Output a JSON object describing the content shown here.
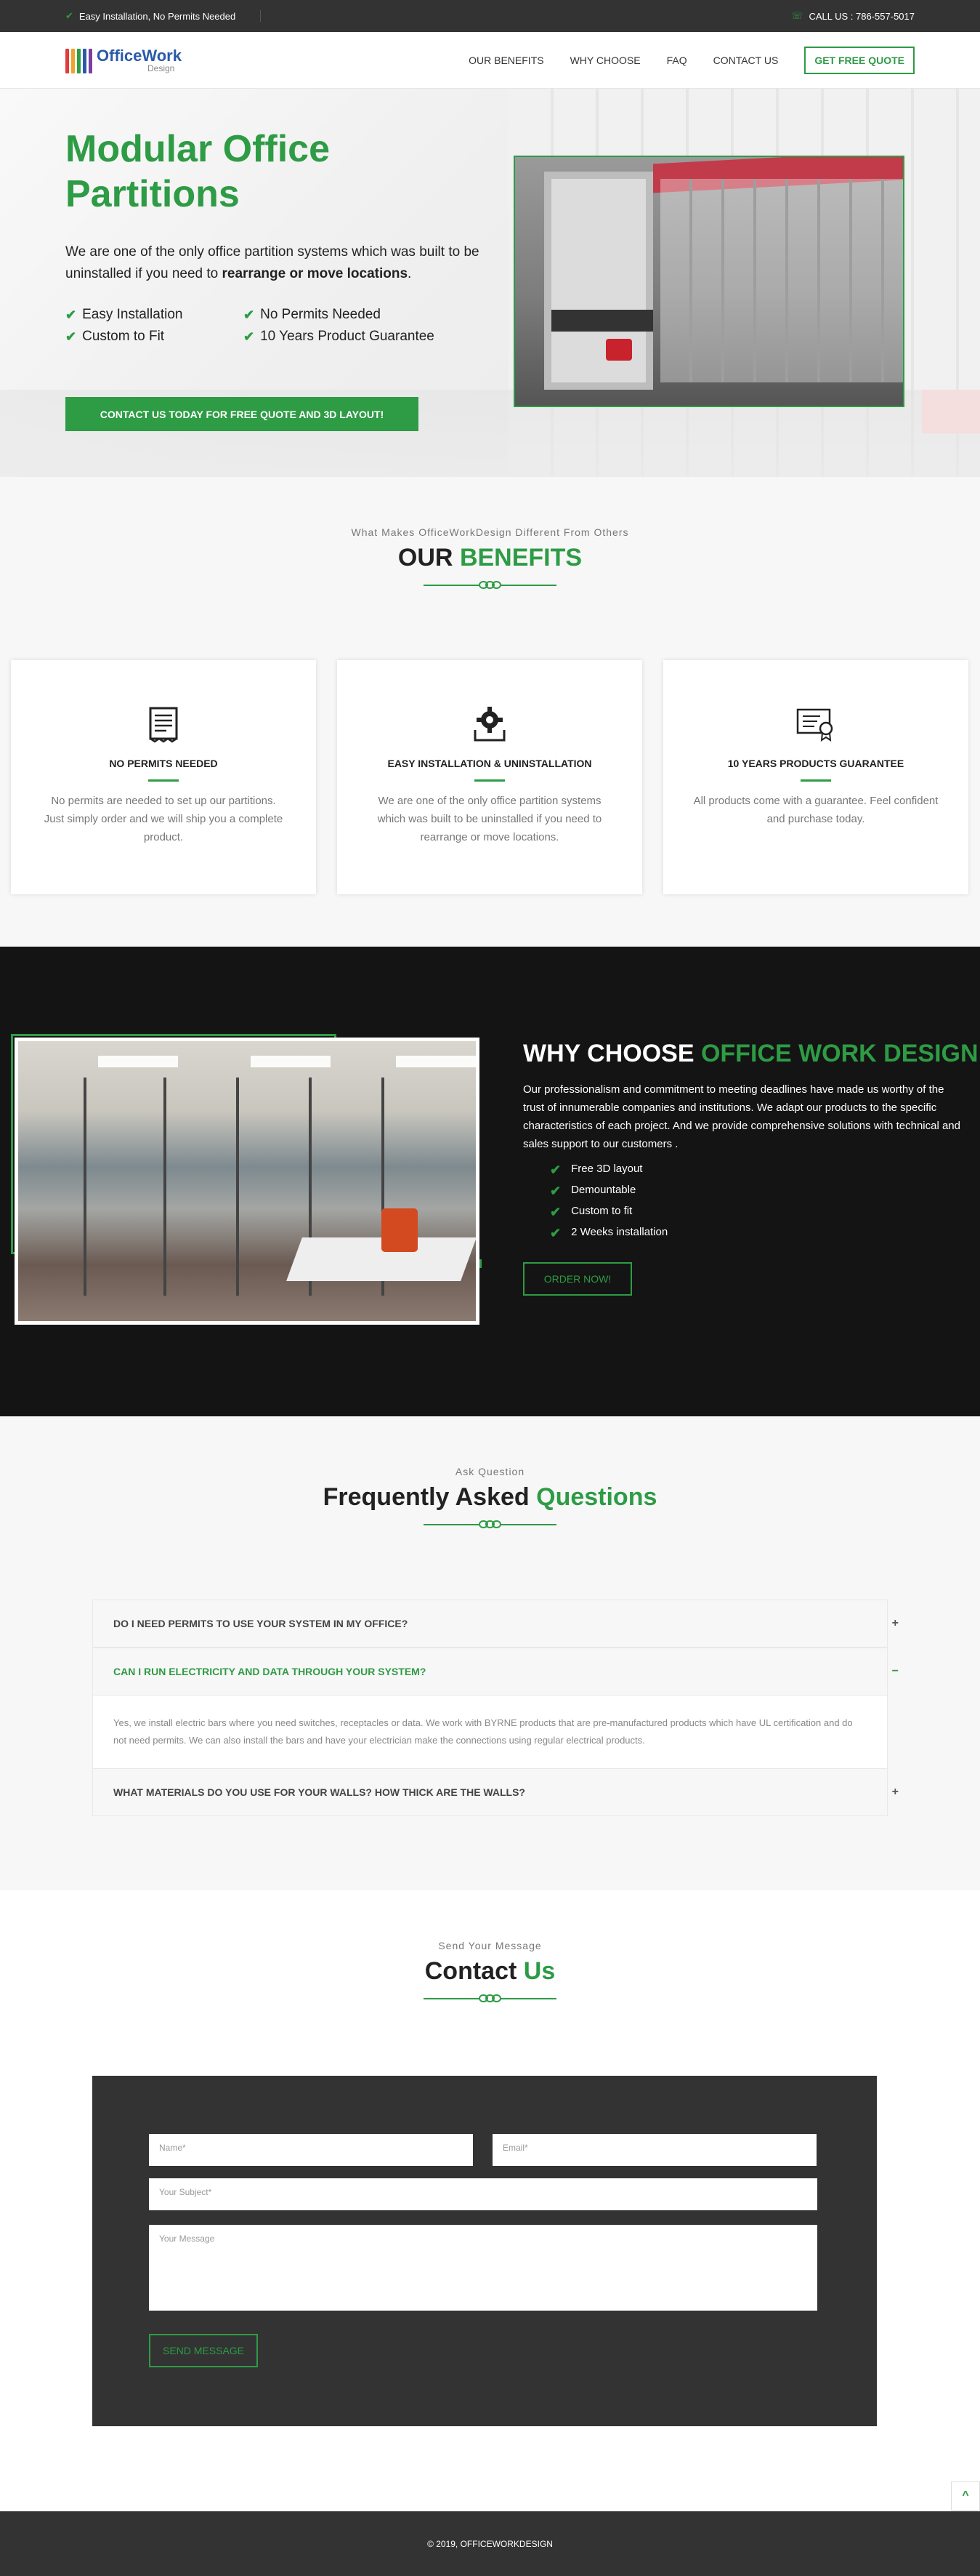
{
  "topbar": {
    "left_text": "Easy Installation, No Permits Needed",
    "right_text": "CALL US : 786-557-5017"
  },
  "logo": {
    "brand": "OfficeWork",
    "sub": "Design",
    "bar_colors": [
      "#e23b3b",
      "#f2a12a",
      "#2e9b45",
      "#2a5aa8",
      "#7b3fa0"
    ]
  },
  "nav": {
    "items": [
      "OUR BENEFITS",
      "WHY CHOOSE",
      "FAQ",
      "CONTACT US"
    ],
    "cta": "GET FREE QUOTE"
  },
  "hero": {
    "title": "Modular Office Partitions",
    "lead_plain": "We are one of the only office partition systems which was built to be uninstalled if you need to ",
    "lead_bold": "rearrange or move locations",
    "lead_end": ".",
    "checks": [
      "Easy Installation",
      "No Permits Needed",
      "Custom to Fit",
      "10 Years Product Guarantee"
    ],
    "button": "CONTACT US TODAY FOR FREE QUOTE AND 3D LAYOUT!"
  },
  "benefits": {
    "subtitle": "What Makes OfficeWorkDesign Different From Others",
    "title_a": "OUR",
    "title_b": "BENEFITS",
    "cards": [
      {
        "icon": "receipt-icon",
        "title": "NO PERMITS NEEDED",
        "text": "No permits are needed to set up our partitions. Just simply order and we will ship you a complete product."
      },
      {
        "icon": "gear-install-icon",
        "title": "EASY INSTALLATION & UNINSTALLATION",
        "text": "We are one of the only office partition systems which was built to be uninstalled if you need to rearrange or move locations."
      },
      {
        "icon": "certificate-icon",
        "title": "10 YEARS PRODUCTS GUARANTEE",
        "text": "All products come with a guarantee. Feel confident and purchase today."
      }
    ]
  },
  "why": {
    "title_a": "WHY CHOOSE",
    "title_b": "OFFICE WORK DESIGN",
    "text": "Our professionalism and commitment to meeting deadlines have made us worthy of the trust of innumerable companies and institutions. We adapt our products to the specific characteristics of each project. And we provide comprehensive solutions with technical and sales support to our customers .",
    "list": [
      "Free 3D layout",
      "Demountable",
      "Custom to fit",
      "2 Weeks installation"
    ],
    "button": "ORDER NOW!"
  },
  "faq": {
    "subtitle": "Ask Question",
    "title_a": "Frequently Asked",
    "title_b": "Questions",
    "items": [
      {
        "q": "DO I NEED PERMITS TO USE YOUR SYSTEM IN MY OFFICE?",
        "sign": "+"
      },
      {
        "q": "CAN I RUN ELECTRICITY AND DATA THROUGH YOUR SYSTEM?",
        "sign": "−",
        "a": "Yes, we install electric bars where you need switches, receptacles or data. We work with BYRNE products that are pre-manufactured products which have UL certification and do not need permits. We can also install the bars and have your electrician make the connections using regular electrical products."
      },
      {
        "q": "WHAT MATERIALS DO YOU USE FOR YOUR WALLS? HOW THICK ARE THE WALLS?",
        "sign": "+"
      }
    ]
  },
  "contact": {
    "subtitle": "Send Your Message",
    "title_a": "Contact",
    "title_b": "Us",
    "name_ph": "Name*",
    "email_ph": "Email*",
    "subject_ph": "Your Subject*",
    "message_ph": "Your Message",
    "button": "SEND MESSAGE"
  },
  "footer": {
    "text": "© 2019, OFFICEWORKDESIGN"
  },
  "totop": {
    "glyph": "^"
  }
}
